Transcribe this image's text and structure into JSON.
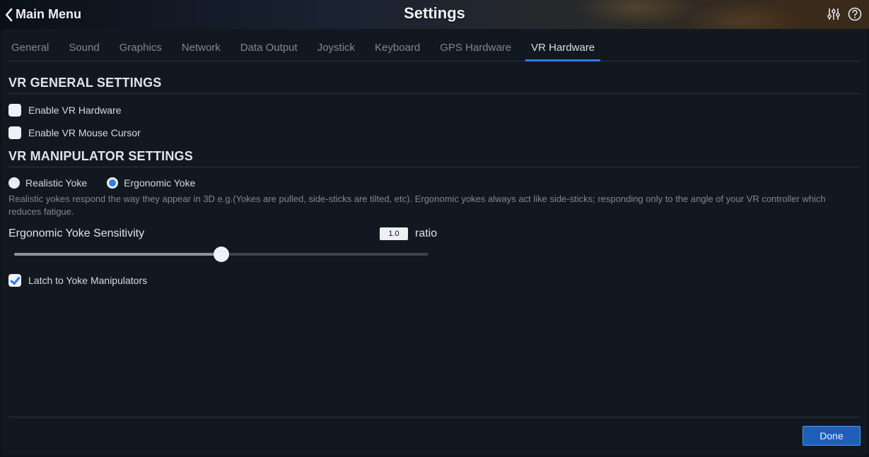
{
  "header": {
    "back_label": "Main Menu",
    "title": "Settings"
  },
  "tabs": [
    {
      "label": "General"
    },
    {
      "label": "Sound"
    },
    {
      "label": "Graphics"
    },
    {
      "label": "Network"
    },
    {
      "label": "Data Output"
    },
    {
      "label": "Joystick"
    },
    {
      "label": "Keyboard"
    },
    {
      "label": "GPS Hardware"
    },
    {
      "label": "VR Hardware",
      "active": true
    }
  ],
  "sections": {
    "general": {
      "title": "VR GENERAL SETTINGS",
      "enable_hw": {
        "label": "Enable VR Hardware",
        "checked": false
      },
      "enable_cursor": {
        "label": "Enable VR Mouse Cursor",
        "checked": false
      }
    },
    "manip": {
      "title": "VR MANIPULATOR SETTINGS",
      "yoke_options": [
        {
          "label": "Realistic Yoke",
          "selected": false
        },
        {
          "label": "Ergonomic Yoke",
          "selected": true
        }
      ],
      "description": "Realistic yokes respond the way they appear in 3D e.g.(Yokes are pulled, side-sticks are tilted, etc). Ergonomic yokes always act like side-sticks; responding only to the angle of your VR controller which reduces fatigue.",
      "sensitivity": {
        "title": "Ergonomic Yoke Sensitivity",
        "value": "1.0",
        "unit": "ratio",
        "percent": 50
      },
      "latch": {
        "label": "Latch to Yoke Manipulators",
        "checked": true
      }
    }
  },
  "footer": {
    "done": "Done"
  }
}
